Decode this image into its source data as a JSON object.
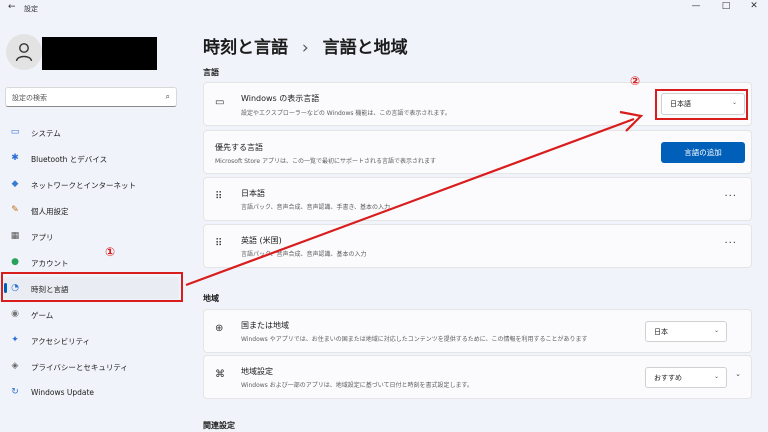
{
  "window": {
    "title": "設定",
    "back": "←",
    "minimize": "—",
    "maximize": "□",
    "close": "✕"
  },
  "sidebar": {
    "search_placeholder": "設定の検索",
    "items": [
      {
        "label": "システム",
        "icon": "monitor-icon",
        "glyph": "▭",
        "color": "#2b6fd6"
      },
      {
        "label": "Bluetooth とデバイス",
        "icon": "bluetooth-icon",
        "glyph": "✱",
        "color": "#2b6fd6"
      },
      {
        "label": "ネットワークとインターネット",
        "icon": "wifi-icon",
        "glyph": "◆",
        "color": "#3a7bd5"
      },
      {
        "label": "個人用設定",
        "icon": "brush-icon",
        "glyph": "✎",
        "color": "#c46a1a"
      },
      {
        "label": "アプリ",
        "icon": "apps-icon",
        "glyph": "▦",
        "color": "#555555"
      },
      {
        "label": "アカウント",
        "icon": "account-icon",
        "glyph": "●",
        "color": "#2aa15a"
      },
      {
        "label": "時刻と言語",
        "icon": "globe-clock-icon",
        "glyph": "◔",
        "color": "#2b6fd6"
      },
      {
        "label": "ゲーム",
        "icon": "gamepad-icon",
        "glyph": "◉",
        "color": "#777777"
      },
      {
        "label": "アクセシビリティ",
        "icon": "accessibility-icon",
        "glyph": "✦",
        "color": "#2b6fd6"
      },
      {
        "label": "プライバシーとセキュリティ",
        "icon": "shield-icon",
        "glyph": "◈",
        "color": "#666666"
      },
      {
        "label": "Windows Update",
        "icon": "update-icon",
        "glyph": "↻",
        "color": "#2b6fd6"
      }
    ]
  },
  "header": {
    "breadcrumb_parent": "時刻と言語",
    "separator": "›",
    "current": "言語と地域"
  },
  "language_section": {
    "title": "言語",
    "display_language": {
      "title": "Windows の表示言語",
      "subtitle": "設定やエクスプローラーなどの Windows 機能は、この言語で表示されます。",
      "value": "日本語",
      "chevron": "⌄"
    },
    "preferred": {
      "title": "優先する言語",
      "subtitle": "Microsoft Store アプリは、この一覧で最初にサポートされる言語で表示されます",
      "button": "言語の追加"
    },
    "languages": [
      {
        "name": "日本語",
        "features": "言語パック、音声合成、音声認識、手書き、基本の入力",
        "more": "···"
      },
      {
        "name": "英語 (米国)",
        "features": "言語パック、音声合成、音声認識、基本の入力",
        "more": "···"
      }
    ]
  },
  "region_section": {
    "title": "地域",
    "country": {
      "title": "国または地域",
      "subtitle": "Windows やアプリでは、お住まいの国または地域に対応したコンテンツを提供するために、この情報を利用することがあります",
      "value": "日本",
      "chevron": "⌄"
    },
    "format": {
      "title": "地域設定",
      "subtitle": "Windows および一部のアプリは、地域設定に基づいて日付と時刻を書式設定します。",
      "value": "おすすめ",
      "chevron": "⌄",
      "expand": "⌄"
    }
  },
  "related_section": {
    "title": "関連設定"
  },
  "annotations": {
    "step1": "①",
    "step2": "②",
    "color": "#d91c1c"
  }
}
